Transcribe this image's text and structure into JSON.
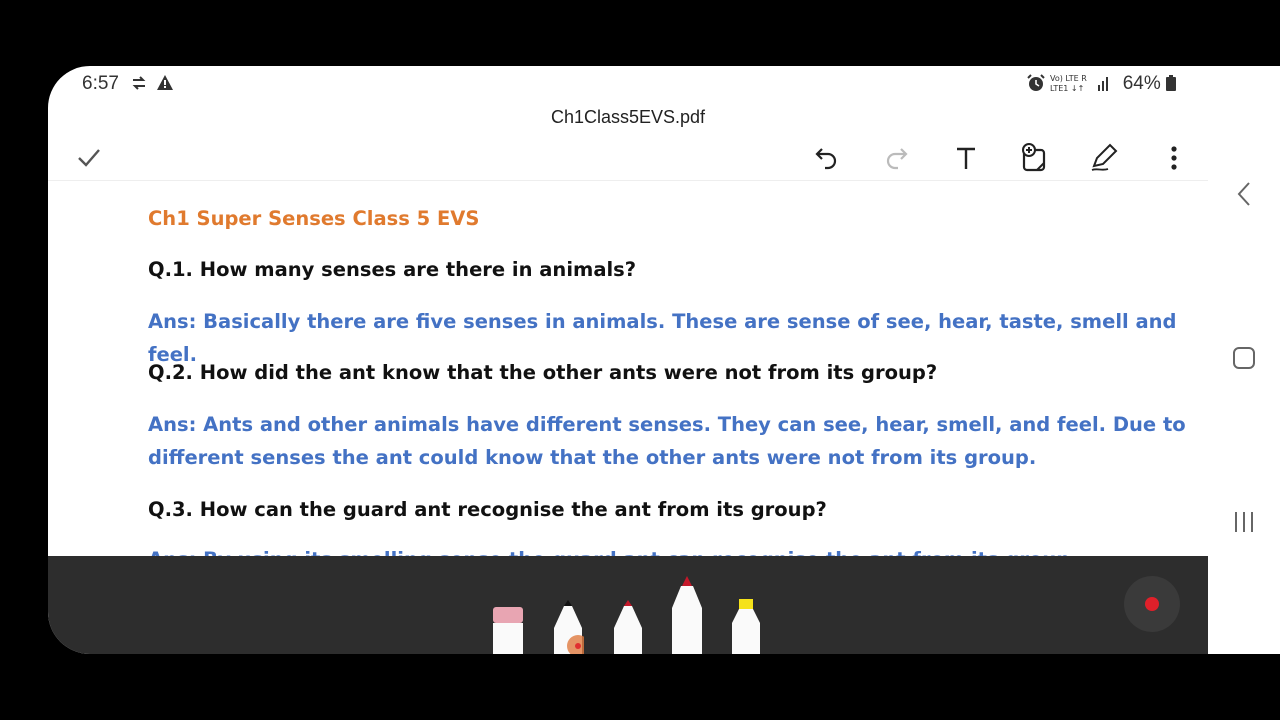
{
  "status_bar": {
    "time": "6:57",
    "battery": "64%"
  },
  "document": {
    "filename": "Ch1Class5EVS.pdf",
    "title": "Ch1 Super Senses Class 5 EVS",
    "q1": "Q.1. How many senses are there in animals?",
    "a1": "Ans: Basically there are five senses in animals. These are sense of see, hear, taste,  smell and feel.",
    "q2": "Q.2. How did the ant know that the other ants were not from its group?",
    "a2": "Ans: Ants and other animals have different senses. They can see, hear, smell, and feel. Due to different senses the ant could know that the other ants were not from its group.",
    "q3": "Q.3. How can the guard ant recognise the ant from its group?",
    "a3_partial": "Ans: By using its smelling sense the guard ant can recognise the ant from its group."
  },
  "toolbar": {
    "icons": [
      "check-icon",
      "undo-icon",
      "redo-icon",
      "text-icon",
      "add-note-icon",
      "pen-icon",
      "more-icon"
    ]
  },
  "pen_tray": {
    "tools": [
      "eraser",
      "black-pen",
      "red-pen",
      "red-marker",
      "yellow-highlighter"
    ],
    "colors": {
      "eraser": "#e8a5b2",
      "black": "#111111",
      "red": "#c4182a",
      "yellow": "#f5e21a"
    }
  },
  "colors": {
    "title": "#e07a2e",
    "question": "#111111",
    "answer": "#4472c4"
  }
}
